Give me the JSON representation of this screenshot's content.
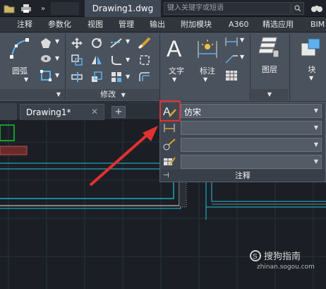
{
  "title_bar": {
    "document_title": "Drawing1.dwg",
    "search_placeholder": "键入关键字或短语",
    "quick_access_icons": [
      "folder-icon",
      "print-icon",
      "more-icon"
    ]
  },
  "ribbon_tabs": [
    "注释",
    "参数化",
    "视图",
    "管理",
    "输出",
    "附加模块",
    "A360",
    "精选应用",
    "BIM"
  ],
  "draw_panel": {
    "arc_label": "圆弧"
  },
  "modify_panel": {
    "label": "修改"
  },
  "annotation_panel": {
    "text_label": "文字",
    "dimension_label": "标注",
    "footer_label": "注释",
    "text_style_value": "仿宋"
  },
  "layers_panel": {
    "label": "图层"
  },
  "block_panel": {
    "label": "块"
  },
  "file_tabs": {
    "active_tab": "Drawing1*"
  },
  "watermark": {
    "text": "搜狗指南",
    "url": "zhinan.sogou.com"
  },
  "colors": {
    "highlight": "#e23030",
    "arrow": "#e23030",
    "drawing_cyan": "#1fc3d8",
    "drawing_green": "#18c22e"
  }
}
